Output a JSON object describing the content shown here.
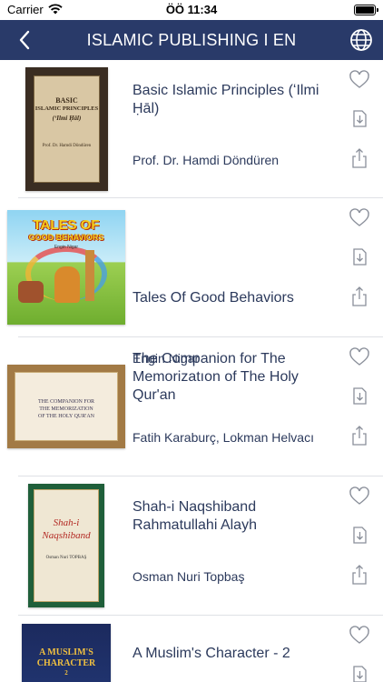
{
  "status_bar": {
    "carrier": "Carrier",
    "time": "ÖÖ 11:34"
  },
  "nav": {
    "title": "ISLAMIC PUBLISHING I EN",
    "back_icon": "chevron-left-icon",
    "globe_icon": "globe-icon"
  },
  "colors": {
    "nav_bg": "#293a69",
    "text": "#2c3a5c",
    "icon": "#8a8f9a",
    "separator": "#dfe1e6"
  },
  "books": [
    {
      "title": "Basic Islamic Principles (ʻIlmi Ḥāl)",
      "author": "Prof. Dr. Hamdi Döndüren",
      "cover": {
        "line1": "BASIC",
        "line2": "ISLAMIC PRINCIPLES",
        "line3": "(ʻIlmi Ḥāl)",
        "author": "Prof. Dr. Hamdi Döndüren"
      }
    },
    {
      "title": "Tales Of Good Behaviors",
      "author": "Engin Nigar",
      "cover": {
        "line1": "TALES OF",
        "line2": "GOOD BEHAVIORS",
        "author": "Engin Nigar"
      }
    },
    {
      "title": "The Companion for The Memorizatıon of The Holy Qur'an",
      "author": "Fatih Karaburç, Lokman Helvacı",
      "cover": {
        "line1": "THE COMPANION FOR",
        "line2": "THE MEMORIZATION",
        "line3": "OF THE HOLY QUR'AN"
      }
    },
    {
      "title": "Shah-i Naqshiband Rahmatullahi Alayh",
      "author": "Osman Nuri Topbaş",
      "cover": {
        "line1": "Shah-i",
        "line2": "Naqshiband",
        "author": "Osman Nuri TOPBAŞ"
      }
    },
    {
      "title": "A Muslim's Character - 2",
      "author": "",
      "cover": {
        "line1": "A MUSLIM'S",
        "line2": "CHARACTER",
        "line3": "2"
      }
    }
  ],
  "actions": {
    "favorite_icon": "heart-icon",
    "download_icon": "download-icon",
    "share_icon": "share-icon"
  }
}
